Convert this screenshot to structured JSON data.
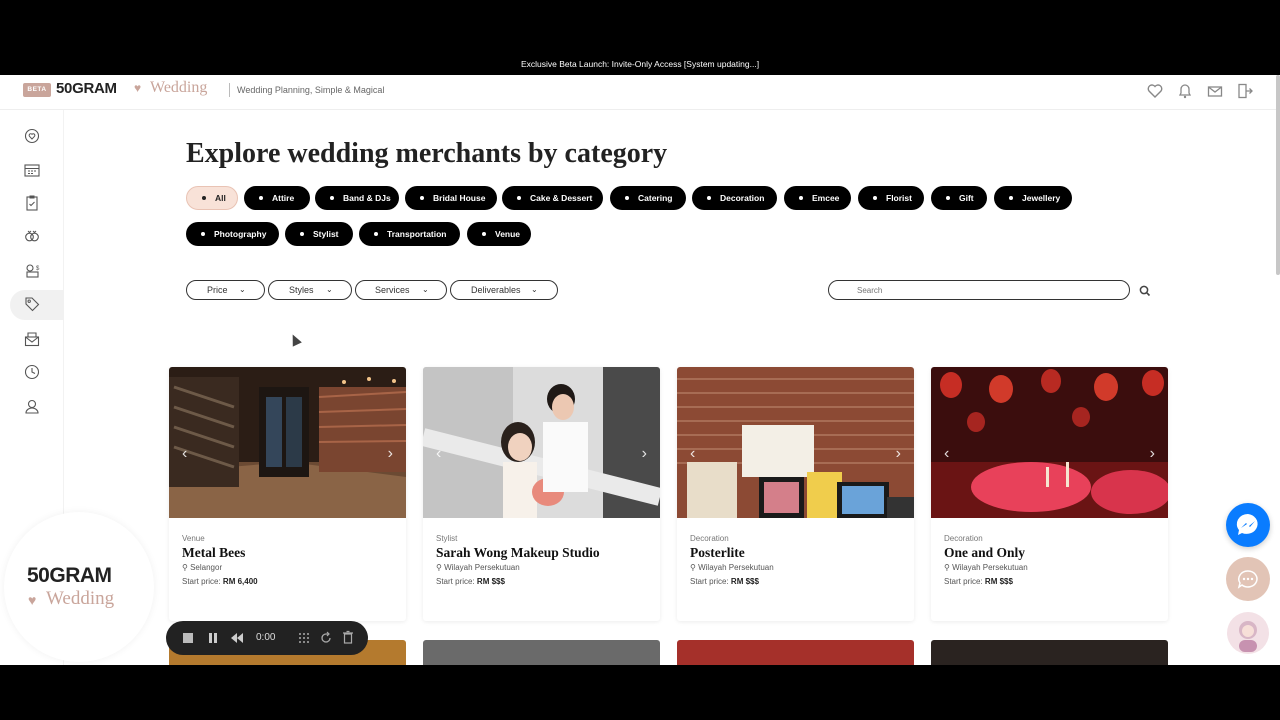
{
  "banner": "Exclusive Beta Launch: Invite-Only Access [System updating...]",
  "header": {
    "beta": "BETA",
    "logo_primary": "50GRAM",
    "logo_secondary": "Wedding",
    "tagline": "Wedding Planning, Simple & Magical",
    "icons": [
      "heart-icon",
      "bell-icon",
      "mail-icon",
      "logout-icon"
    ]
  },
  "sidebar": {
    "icons": [
      "map-pin-heart-icon",
      "calendar-icon",
      "checklist-icon",
      "rings-icon",
      "budget-icon",
      "tag-icon",
      "invitation-icon",
      "clock-icon",
      "guest-icon"
    ],
    "active_index": 5,
    "logo_primary": "50GRAM",
    "logo_secondary": "Wedding"
  },
  "main": {
    "title": "Explore wedding merchants by category",
    "categories": [
      "All",
      "Attire",
      "Band & DJs",
      "Bridal House",
      "Cake & Dessert",
      "Catering",
      "Decoration",
      "Emcee",
      "Florist",
      "Gift",
      "Jewellery",
      "Photography",
      "Stylist",
      "Transportation",
      "Venue"
    ],
    "active_category": "All",
    "filters": [
      "Price",
      "Styles",
      "Services",
      "Deliverables"
    ],
    "search_placeholder": "Search"
  },
  "cards": [
    {
      "category": "Venue",
      "name": "Metal Bees",
      "location": "Selangor",
      "price_label": "Start price:",
      "price": "RM 6,400"
    },
    {
      "category": "Stylist",
      "name": "Sarah Wong Makeup Studio",
      "location": "Wilayah Persekutuan",
      "price_label": "Start price:",
      "price": "RM $$$"
    },
    {
      "category": "Decoration",
      "name": "Posterlite",
      "location": "Wilayah Persekutuan",
      "price_label": "Start price:",
      "price": "RM $$$"
    },
    {
      "category": "Decoration",
      "name": "One and Only",
      "location": "Wilayah Persekutuan",
      "price_label": "Start price:",
      "price": "RM $$$"
    }
  ],
  "recorder": {
    "time": "0:00"
  },
  "colors": {
    "accent": "#c9a59b",
    "chip_bg": "#000000",
    "chip_active_bg": "#f8e2d8",
    "messenger": "#0a7cff"
  }
}
